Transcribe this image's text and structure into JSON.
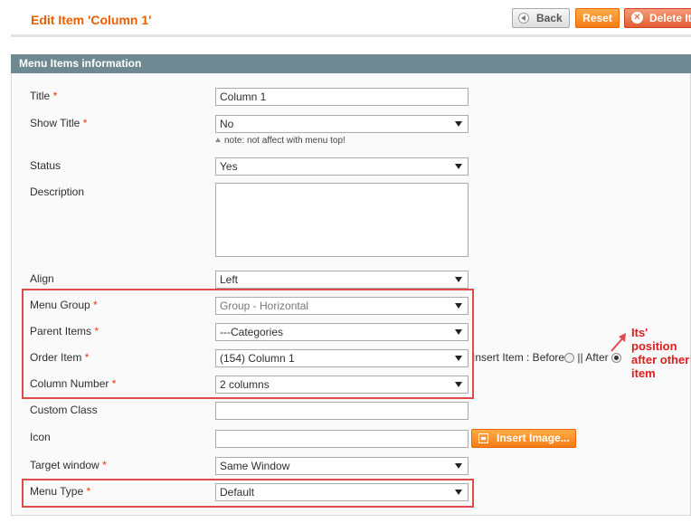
{
  "header": {
    "title": "Edit Item 'Column 1'",
    "back_label": "Back",
    "reset_label": "Reset",
    "delete_label": "Delete Item"
  },
  "section": {
    "title": "Menu Items information"
  },
  "fields": {
    "title": {
      "label": "Title",
      "value": "Column 1"
    },
    "show_title": {
      "label": "Show Title",
      "value": "No",
      "note": "note: not affect with menu top!"
    },
    "status": {
      "label": "Status",
      "value": "Yes"
    },
    "description": {
      "label": "Description",
      "value": ""
    },
    "align": {
      "label": "Align",
      "value": "Left"
    },
    "menu_group": {
      "label": "Menu Group",
      "value": "Group - Horizontal"
    },
    "parent_items": {
      "label": "Parent Items",
      "value": "---Categories"
    },
    "order_item": {
      "label": "Order Item",
      "value": "(154) Column 1",
      "insert_label": "Insert Item : Before",
      "after_label": "|| After"
    },
    "column_number": {
      "label": "Column Number",
      "value": "2 columns"
    },
    "custom_class": {
      "label": "Custom Class",
      "value": ""
    },
    "icon": {
      "label": "Icon",
      "value": "",
      "insert_image_label": "Insert Image..."
    },
    "target_window": {
      "label": "Target window",
      "value": "Same Window"
    },
    "menu_type": {
      "label": "Menu Type",
      "value": "Default"
    }
  },
  "required_mark": "*",
  "annotation": {
    "text": "Its' position after other item"
  },
  "colors": {
    "accent": "#eb5e00",
    "section_header": "#6f8992",
    "highlight": "#e0494e",
    "annotation": "#e01c1c"
  }
}
